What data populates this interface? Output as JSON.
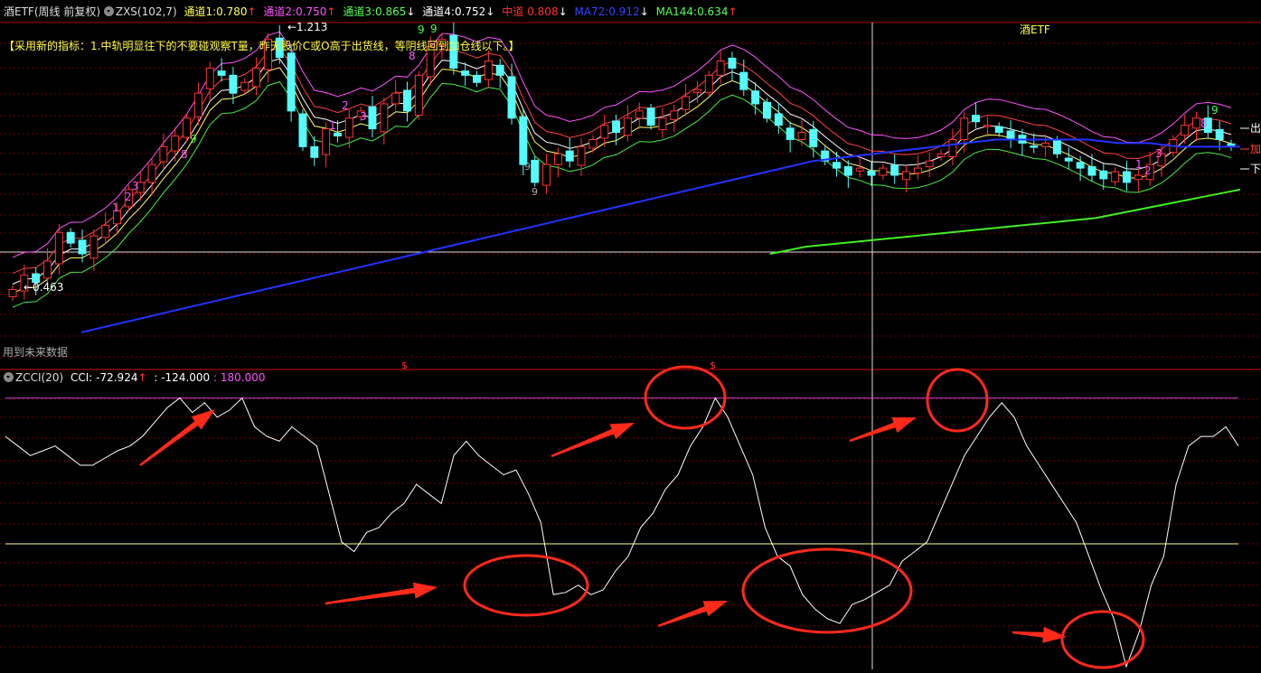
{
  "header": {
    "symbol": "酒ETF",
    "period": "(周线 前复权)",
    "indicator_name": "ZXS(102,7)",
    "ind1_label": "通道1:",
    "ind1_value": "0.780",
    "ind1_arrow": "↑",
    "ind2_label": "通道2:",
    "ind2_value": "0.750",
    "ind2_arrow": "↑",
    "ind3_label": "通道3:",
    "ind3_value": "0.865",
    "ind3_arrow": "↓",
    "ind4_label": "通道4:",
    "ind4_value": "0.752",
    "ind4_arrow": "↓",
    "mid_label": "中道",
    "mid_value": "0.808",
    "mid_arrow": "↓",
    "ma72_label": "MA72:",
    "ma72_value": "0.912",
    "ma72_arrow": "↓",
    "ma144_label": "MA144:",
    "ma144_value": "0.634",
    "ma144_arrow": "↑"
  },
  "main_panel": {
    "note": "【采用新的指标：1.中轨明显往下的不要碰观察T量，昨天股价C或O高于出货线，等阴线回到加仓线以下。】",
    "chart_title": "酒ETF",
    "price_high_label": "1.213",
    "price_low_label": "0.463",
    "future_data_label": "用到未来数据",
    "right_labels": [
      "出",
      "加",
      "下"
    ],
    "dollar_marker": "$",
    "td_counts": [
      "1",
      "2",
      "3",
      "8",
      "9",
      "1",
      "2",
      "3",
      "8",
      "9",
      "9",
      "1",
      "2",
      "3",
      "8",
      "9",
      "1",
      "2",
      "3",
      "8",
      "9"
    ]
  },
  "cci_panel": {
    "header_name": "ZCCI(20)",
    "header_cci": "CCI: -72.924",
    "header_arrow": "↑",
    "header_low": ": -124.000",
    "header_high": ": 180.000"
  },
  "colors": {
    "background": "#000000",
    "up_candle": "#ff3333",
    "down_candle": "#54fcfc",
    "channel1": "#ff55ff",
    "channel2": "#ff4040",
    "channel3": "#ffffff",
    "channel4": "#ffff66",
    "lower_channel": "#44ee44",
    "ma72": "#2233ff",
    "ma144": "#44ee22",
    "cci": "#ffffff",
    "annotation": "#ff2a1a",
    "upper_level": "#cc44cc",
    "lower_level": "#ffff99"
  },
  "chart_data": [
    {
      "type": "candlestick",
      "title": "",
      "closes": [
        0.5,
        0.54,
        0.52,
        0.58,
        0.66,
        0.63,
        0.6,
        0.65,
        0.68,
        0.72,
        0.78,
        0.8,
        0.85,
        0.9,
        0.93,
        0.98,
        1.05,
        1.12,
        1.1,
        1.05,
        1.08,
        1.12,
        1.2,
        1.15,
        1.0,
        0.9,
        0.87,
        0.95,
        0.93,
        0.98,
        1.0,
        0.95,
        1.02,
        1.05,
        1.0,
        1.1,
        1.18,
        1.2,
        1.12,
        1.1,
        1.08,
        1.14,
        1.1,
        0.98,
        0.85,
        0.8,
        0.85,
        0.88,
        0.86,
        0.9,
        0.92,
        0.96,
        0.94,
        0.98,
        1.0,
        0.96,
        0.98,
        1.0,
        1.04,
        1.06,
        1.1,
        1.14,
        1.12,
        1.06,
        1.02,
        0.98,
        0.96,
        0.92,
        0.94,
        0.9,
        0.86,
        0.84,
        0.82,
        0.84,
        0.82,
        0.84,
        0.82,
        0.83,
        0.84,
        0.86,
        0.88,
        0.92,
        0.98,
        0.97,
        0.96,
        0.94,
        0.92,
        0.91,
        0.9,
        0.91,
        0.88,
        0.86,
        0.84,
        0.82,
        0.81,
        0.83,
        0.8,
        0.82,
        0.85,
        0.88,
        0.92,
        0.96,
        0.98,
        0.94,
        0.92,
        0.9
      ],
      "ma72": [
        0.38,
        0.4,
        0.42,
        0.44,
        0.46,
        0.48,
        0.5,
        0.52,
        0.54,
        0.56,
        0.58,
        0.6,
        0.62,
        0.64,
        0.66,
        0.68,
        0.7,
        0.72,
        0.74,
        0.76,
        0.78,
        0.8,
        0.82,
        0.84,
        0.86,
        0.87,
        0.88,
        0.89,
        0.9,
        0.91,
        0.92,
        0.92,
        0.92,
        0.92,
        0.91,
        0.91,
        0.9,
        0.9,
        0.9
      ],
      "ma144": [
        0.6,
        0.62,
        0.63,
        0.64,
        0.65,
        0.66,
        0.67,
        0.68,
        0.69,
        0.7,
        0.72,
        0.74,
        0.76,
        0.78
      ],
      "price_high": 1.213,
      "price_low": 0.463
    },
    {
      "type": "line",
      "title": "",
      "series": [
        {
          "name": "CCI",
          "values": [
            100,
            80,
            60,
            70,
            80,
            60,
            40,
            40,
            55,
            70,
            80,
            100,
            130,
            160,
            180,
            150,
            170,
            140,
            155,
            180,
            120,
            100,
            90,
            120,
            100,
            80,
            -20,
            -120,
            -140,
            -100,
            -90,
            -60,
            -40,
            0,
            -20,
            -40,
            60,
            90,
            60,
            40,
            20,
            30,
            -20,
            -80,
            -230,
            -225,
            -210,
            -230,
            -220,
            -180,
            -150,
            -90,
            -60,
            -10,
            20,
            80,
            120,
            180,
            140,
            80,
            20,
            -90,
            -150,
            -170,
            -230,
            -260,
            -280,
            -290,
            -250,
            -240,
            -225,
            -210,
            -160,
            -140,
            -120,
            -60,
            0,
            60,
            100,
            140,
            170,
            140,
            80,
            40,
            0,
            -40,
            -80,
            -150,
            -220,
            -280,
            -380,
            -310,
            -210,
            -150,
            0,
            80,
            100,
            100,
            120,
            80
          ]
        }
      ],
      "levels": [
        180,
        -124
      ],
      "ylim": [
        -380,
        200
      ]
    }
  ]
}
